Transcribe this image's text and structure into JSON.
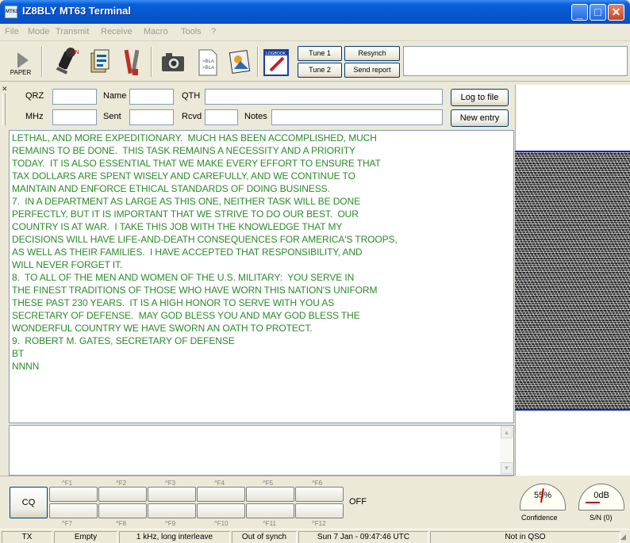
{
  "window": {
    "title": "IZ8BLY MT63 Terminal",
    "app_icon_text": "MT63"
  },
  "menu": [
    "File",
    "Mode",
    "Transmit",
    "Receive",
    "Macro",
    "Tools",
    "?"
  ],
  "toolbar": {
    "paper_label": "PAPER",
    "tune1": "Tune 1",
    "tune2": "Tune 2",
    "resynch": "Resynch",
    "send_report": "Send report",
    "logbook_text": "LOGBOOK"
  },
  "log": {
    "qrz_label": "QRZ",
    "qrz_value": "",
    "name_label": "Name",
    "name_value": "",
    "qth_label": "QTH",
    "qth_value": "",
    "mhz_label": "MHz",
    "mhz_value": "",
    "sent_label": "Sent",
    "sent_value": "",
    "rcvd_label": "Rcvd",
    "rcvd_value": "",
    "notes_label": "Notes",
    "notes_value": "",
    "log_to_file": "Log to file",
    "new_entry": "New entry"
  },
  "rx_lines": [
    "LETHAL, AND MORE EXPEDITIONARY.  MUCH HAS BEEN ACCOMPLISHED, MUCH",
    "REMAINS TO BE DONE.  THIS TASK REMAINS A NECESSITY AND A PRIORITY",
    "TODAY.  IT IS ALSO ESSENTIAL THAT WE MAKE EVERY EFFORT TO ENSURE THAT",
    "TAX DOLLARS ARE SPENT WISELY AND CAREFULLY, AND WE CONTINUE TO",
    "MAINTAIN AND ENFORCE ETHICAL STANDARDS OF DOING BUSINESS.",
    "7.  IN A DEPARTMENT AS LARGE AS THIS ONE, NEITHER TASK WILL BE DONE",
    "PERFECTLY, BUT IT IS IMPORTANT THAT WE STRIVE TO DO OUR BEST.  OUR",
    "COUNTRY IS AT WAR.  I TAKE THIS JOB WITH THE KNOWLEDGE THAT MY",
    "DECISIONS WILL HAVE LIFE-AND-DEATH CONSEQUENCES FOR AMERICA'S TROOPS,",
    "AS WELL AS THEIR FAMILIES.  I HAVE ACCEPTED THAT RESPONSIBILITY, AND",
    "WILL NEVER FORGET IT.",
    "8.  TO ALL OF THE MEN AND WOMEN OF THE U.S. MILITARY:  YOU SERVE IN",
    "THE FINEST TRADITIONS OF THOSE WHO HAVE WORN THIS NATION'S UNIFORM",
    "THESE PAST 230 YEARS.  IT IS A HIGH HONOR TO SERVE WITH YOU AS",
    "SECRETARY OF DEFENSE.  MAY GOD BLESS YOU AND MAY GOD BLESS THE",
    "WONDERFUL COUNTRY WE HAVE SWORN AN OATH TO PROTECT.",
    "9.  ROBERT M. GATES, SECRETARY OF DEFENSE",
    "BT",
    "NNNN"
  ],
  "tx_text": "",
  "macros": {
    "cq": "CQ",
    "off": "OFF",
    "top_keys": [
      "^F1",
      "^F2",
      "^F3",
      "^F4",
      "^F5",
      "^F6"
    ],
    "bottom_keys": [
      "^F7",
      "^F8",
      "^F9",
      "^F10",
      "^F11",
      "^F12"
    ]
  },
  "meters": {
    "confidence_value": "55%",
    "confidence_label": "Confidence",
    "confidence_level": 0.55,
    "sn_value": "0dB",
    "sn_label": "S/N (0)"
  },
  "status": {
    "mode": "TX",
    "buffer": "Empty",
    "bandwidth": "1 kHz, long interleave",
    "sync": "Out of synch",
    "datetime": "Sun 7 Jan - 09:47:46 UTC",
    "qso": "Not in QSO"
  },
  "colors": {
    "rx_text": "#2a8a2a",
    "waterfall_marker": "#1020d0",
    "titlebar": "#0558d0"
  }
}
